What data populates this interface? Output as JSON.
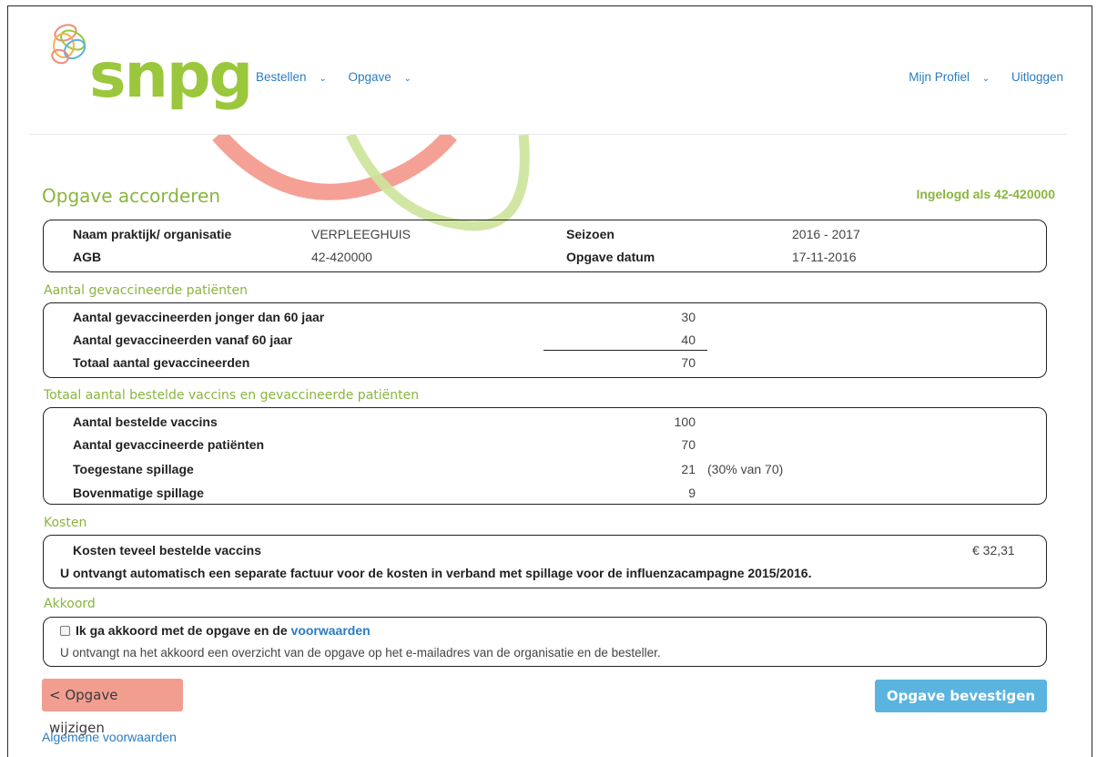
{
  "header": {
    "logo_text": "snpg",
    "nav_left": [
      {
        "label": "Bestellen",
        "chevron": "⌄"
      },
      {
        "label": "Opgave",
        "chevron": "⌄"
      }
    ],
    "profile_label": "Mijn Profiel",
    "profile_chevron": "⌄",
    "logout_label": "Uitloggen"
  },
  "page": {
    "title": "Opgave accorderen",
    "logged_in": "Ingelogd als 42-420000"
  },
  "info": {
    "org_label": "Naam praktijk/ organisatie",
    "org_value": "VERPLEEGHUIS",
    "season_label": "Seizoen",
    "season_value": "2016 - 2017",
    "agb_label": "AGB",
    "agb_value": "42-420000",
    "date_label": "Opgave datum",
    "date_value": "17-11-2016"
  },
  "vaccinated": {
    "title": "Aantal gevaccineerde patiënten",
    "rows": [
      {
        "label": "Aantal gevaccineerden jonger dan 60 jaar",
        "value": "30"
      },
      {
        "label": "Aantal gevaccineerden vanaf 60 jaar",
        "value": "40"
      },
      {
        "label": "Totaal aantal gevaccineerden",
        "value": "70"
      }
    ]
  },
  "totals": {
    "title": "Totaal aantal bestelde vaccins en gevaccineerde patiënten",
    "rows": [
      {
        "label": "Aantal bestelde vaccins",
        "value": "100",
        "note": ""
      },
      {
        "label": "Aantal gevaccineerde patiënten",
        "value": "70",
        "note": ""
      },
      {
        "label": "Toegestane spillage",
        "value": "21",
        "note": "(30% van 70)"
      },
      {
        "label": "Bovenmatige spillage",
        "value": "9",
        "note": ""
      }
    ]
  },
  "costs": {
    "title": "Kosten",
    "label": "Kosten teveel bestelde vaccins",
    "amount": "€ 32,31",
    "notice": "U ontvangt automatisch een separate factuur voor de kosten in verband met spillage voor de influenzacampagne 2015/2016."
  },
  "agree": {
    "title": "Akkoord",
    "checkbox_text": "Ik ga akkoord met de opgave en de",
    "checkbox_link": "voorwaarden",
    "checked": false,
    "info": "U ontvangt na het akkoord een overzicht van de opgave op het e-mailadres van de organisatie en de besteller."
  },
  "buttons": {
    "back": "< Opgave wijzigen",
    "confirm": "Opgave bevestigen"
  },
  "footer": {
    "link": "Algemene voorwaarden"
  },
  "colors": {
    "brand_green": "#9bc73c",
    "link_blue": "#2a7cc2",
    "back_button": "#f19e90",
    "confirm_button": "#5ab4df"
  }
}
